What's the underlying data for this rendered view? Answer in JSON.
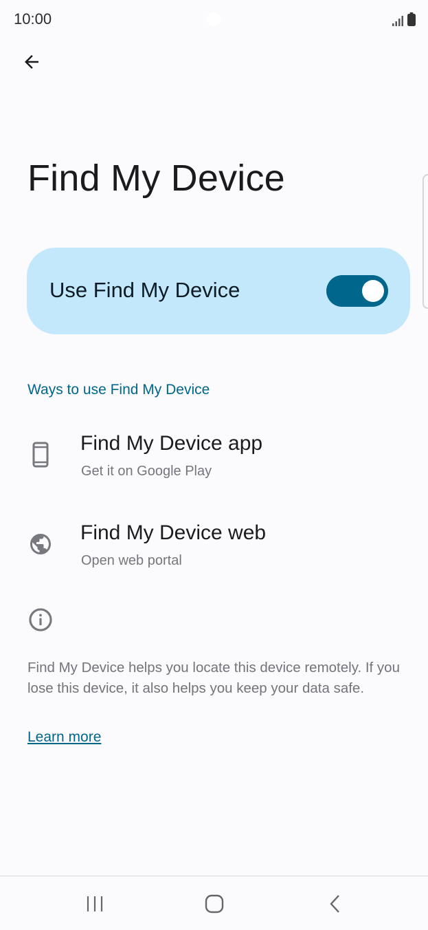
{
  "status_bar": {
    "time": "10:00",
    "icons": [
      "signal-icon",
      "battery-icon"
    ]
  },
  "toolbar": {
    "back_icon": "arrow-back-icon"
  },
  "page": {
    "title": "Find My Device"
  },
  "main_switch": {
    "label": "Use Find My Device",
    "checked": true,
    "accent_color": "#00668b",
    "card_color": "#c4e8fb"
  },
  "section": {
    "header": "Ways to use Find My Device",
    "items": [
      {
        "icon": "phone-icon",
        "title": "Find My Device app",
        "summary": "Get it on Google Play"
      },
      {
        "icon": "globe-icon",
        "title": "Find My Device web",
        "summary": "Open web portal"
      }
    ]
  },
  "footer": {
    "icon": "info-icon",
    "text": "Find My Device helps you locate this device remotely. If you lose this device, it also helps you keep your data safe.",
    "link": "Learn more"
  },
  "nav_bar": {
    "buttons": [
      "recents-icon",
      "home-icon",
      "back-icon"
    ]
  }
}
